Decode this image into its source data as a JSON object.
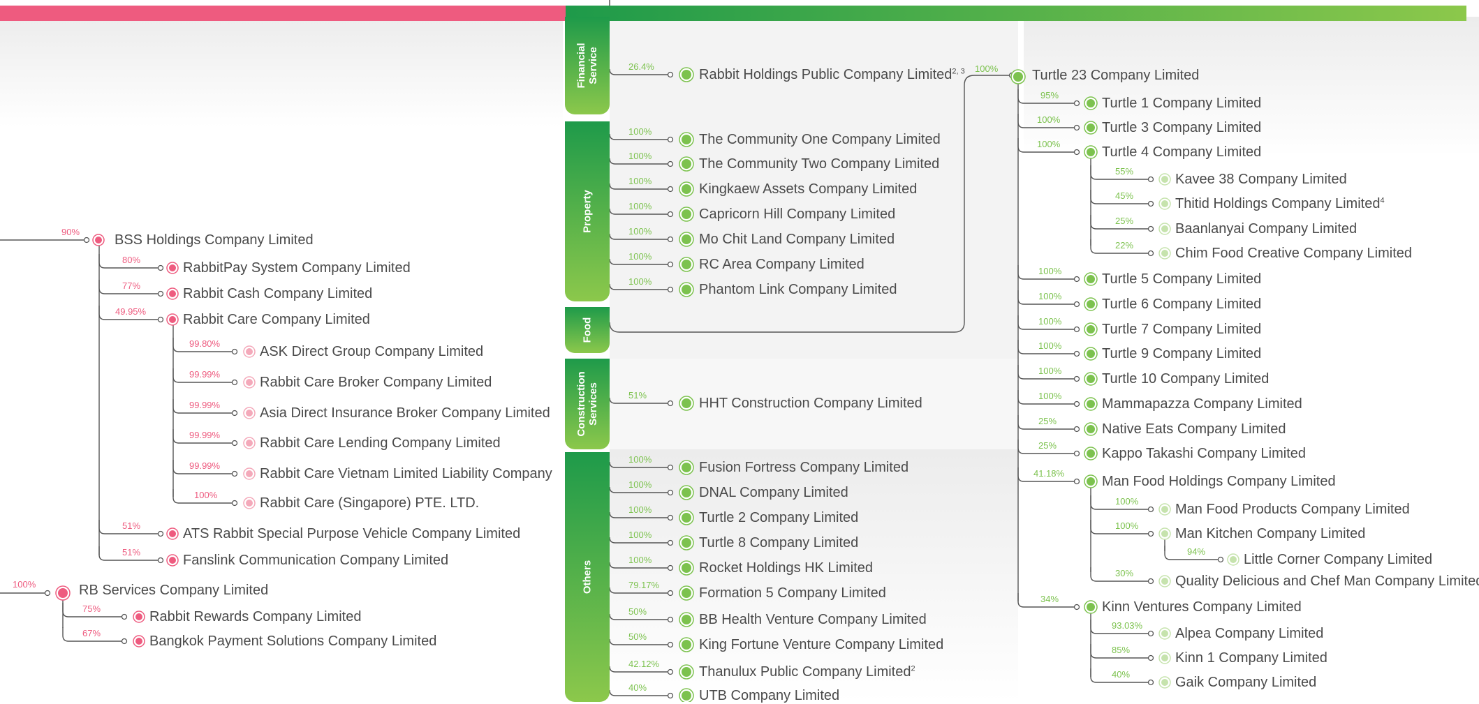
{
  "colors": {
    "pink": "#ee5b7f",
    "pink_light": "#f4a9ba",
    "green_dark": "#1e9a4a",
    "green": "#7cc24e",
    "green_light": "#c6e3ad",
    "line": "#555555",
    "text": "#4a4a4a"
  },
  "categories": [
    {
      "key": "financial",
      "label": "Financial Service"
    },
    {
      "key": "property",
      "label": "Property"
    },
    {
      "key": "food",
      "label": "Food"
    },
    {
      "key": "construction",
      "label": "Construction Services"
    },
    {
      "key": "others",
      "label": "Others"
    }
  ],
  "left_tree": {
    "bss": {
      "name": "BSS Holdings Company Limited",
      "pct": "90%"
    },
    "bss_children": [
      {
        "name": "RabbitPay System Company Limited",
        "pct": "80%"
      },
      {
        "name": "Rabbit Cash Company Limited",
        "pct": "77%"
      },
      {
        "name": "Rabbit Care Company Limited",
        "pct": "49.95%"
      }
    ],
    "care_children": [
      {
        "name": "ASK Direct Group Company Limited",
        "pct": "99.80%"
      },
      {
        "name": "Rabbit Care Broker Company Limited",
        "pct": "99.99%"
      },
      {
        "name": "Asia Direct Insurance Broker Company Limited",
        "pct": "99.99%"
      },
      {
        "name": "Rabbit Care Lending Company Limited",
        "pct": "99.99%"
      },
      {
        "name": "Rabbit Care Vietnam Limited Liability Company",
        "pct": "99.99%"
      },
      {
        "name": "Rabbit Care (Singapore) PTE. LTD.",
        "pct": "100%"
      }
    ],
    "bss_children_lower": [
      {
        "name": "ATS Rabbit Special Purpose Vehicle Company Limited",
        "pct": "51%"
      },
      {
        "name": "Fanslink Communication Company Limited",
        "pct": "51%"
      }
    ],
    "rb": {
      "name": "RB Services Company Limited",
      "pct": "100%"
    },
    "rb_children": [
      {
        "name": "Rabbit Rewards Company Limited",
        "pct": "75%"
      },
      {
        "name": "Bangkok Payment Solutions Company Limited",
        "pct": "67%"
      }
    ]
  },
  "middle": {
    "financial": [
      {
        "name": "Rabbit Holdings Public Company Limited",
        "sup": "2, 3",
        "pct": "26.4%"
      }
    ],
    "property": [
      {
        "name": "The Community One Company Limited",
        "pct": "100%"
      },
      {
        "name": "The Community Two Company Limited",
        "pct": "100%"
      },
      {
        "name": "Kingkaew Assets Company Limited",
        "pct": "100%"
      },
      {
        "name": "Capricorn Hill Company Limited",
        "pct": "100%"
      },
      {
        "name": "Mo Chit Land Company Limited",
        "pct": "100%"
      },
      {
        "name": "RC Area Company Limited",
        "pct": "100%"
      },
      {
        "name": "Phantom Link Company Limited",
        "pct": "100%"
      }
    ],
    "construction": [
      {
        "name": "HHT Construction Company Limited",
        "pct": "51%"
      }
    ],
    "others": [
      {
        "name": "Fusion Fortress Company Limited",
        "pct": "100%"
      },
      {
        "name": "DNAL Company Limited",
        "pct": "100%"
      },
      {
        "name": "Turtle 2 Company Limited",
        "pct": "100%"
      },
      {
        "name": "Turtle 8 Company Limited",
        "pct": "100%"
      },
      {
        "name": "Rocket Holdings HK Limited",
        "pct": "100%"
      },
      {
        "name": "Formation 5 Company Limited",
        "pct": "79.17%"
      },
      {
        "name": "BB Health Venture Company Limited",
        "pct": "50%"
      },
      {
        "name": "King Fortune Venture Company Limited",
        "pct": "50%"
      },
      {
        "name": "Thanulux Public Company Limited",
        "sup": "2",
        "pct": "42.12%"
      },
      {
        "name": "UTB Company Limited",
        "pct": "40%"
      }
    ]
  },
  "right_tree": {
    "root": {
      "name": "Turtle 23 Company Limited",
      "pct": "100%"
    },
    "level1_a": [
      {
        "name": "Turtle 1 Company Limited",
        "pct": "95%"
      },
      {
        "name": "Turtle 3 Company Limited",
        "pct": "100%"
      },
      {
        "name": "Turtle 4 Company Limited",
        "pct": "100%"
      }
    ],
    "turtle4_children": [
      {
        "name": "Kavee 38 Company Limited",
        "pct": "55%"
      },
      {
        "name": "Thitid Holdings Company Limited",
        "sup": "4",
        "pct": "45%"
      },
      {
        "name": "Baanlanyai Company Limited",
        "pct": "25%"
      },
      {
        "name": "Chim Food Creative Company Limited",
        "pct": "22%"
      }
    ],
    "level1_b": [
      {
        "name": "Turtle 5 Company Limited",
        "pct": "100%"
      },
      {
        "name": "Turtle 6 Company Limited",
        "pct": "100%"
      },
      {
        "name": "Turtle 7 Company Limited",
        "pct": "100%"
      },
      {
        "name": "Turtle 9 Company Limited",
        "pct": "100%"
      },
      {
        "name": "Turtle 10 Company Limited",
        "pct": "100%"
      },
      {
        "name": "Mammapazza Company Limited",
        "pct": "100%"
      },
      {
        "name": "Native Eats Company Limited",
        "pct": "25%"
      },
      {
        "name": "Kappo Takashi Company Limited",
        "pct": "25%"
      },
      {
        "name": "Man Food Holdings Company Limited",
        "pct": "41.18%"
      }
    ],
    "manfood_children": [
      {
        "name": "Man Food Products Company Limited",
        "pct": "100%"
      },
      {
        "name": "Man Kitchen Company Limited",
        "pct": "100%"
      },
      {
        "name": "Quality Delicious and Chef Man Company Limited",
        "pct": "30%"
      }
    ],
    "mankitchen_children": [
      {
        "name": "Little Corner Company Limited",
        "pct": "94%"
      }
    ],
    "kinn": {
      "name": "Kinn Ventures Company Limited",
      "pct": "34%"
    },
    "kinn_children": [
      {
        "name": "Alpea Company Limited",
        "pct": "93.03%"
      },
      {
        "name": "Kinn 1 Company Limited",
        "pct": "85%"
      },
      {
        "name": "Gaik Company Limited",
        "pct": "40%"
      }
    ]
  }
}
